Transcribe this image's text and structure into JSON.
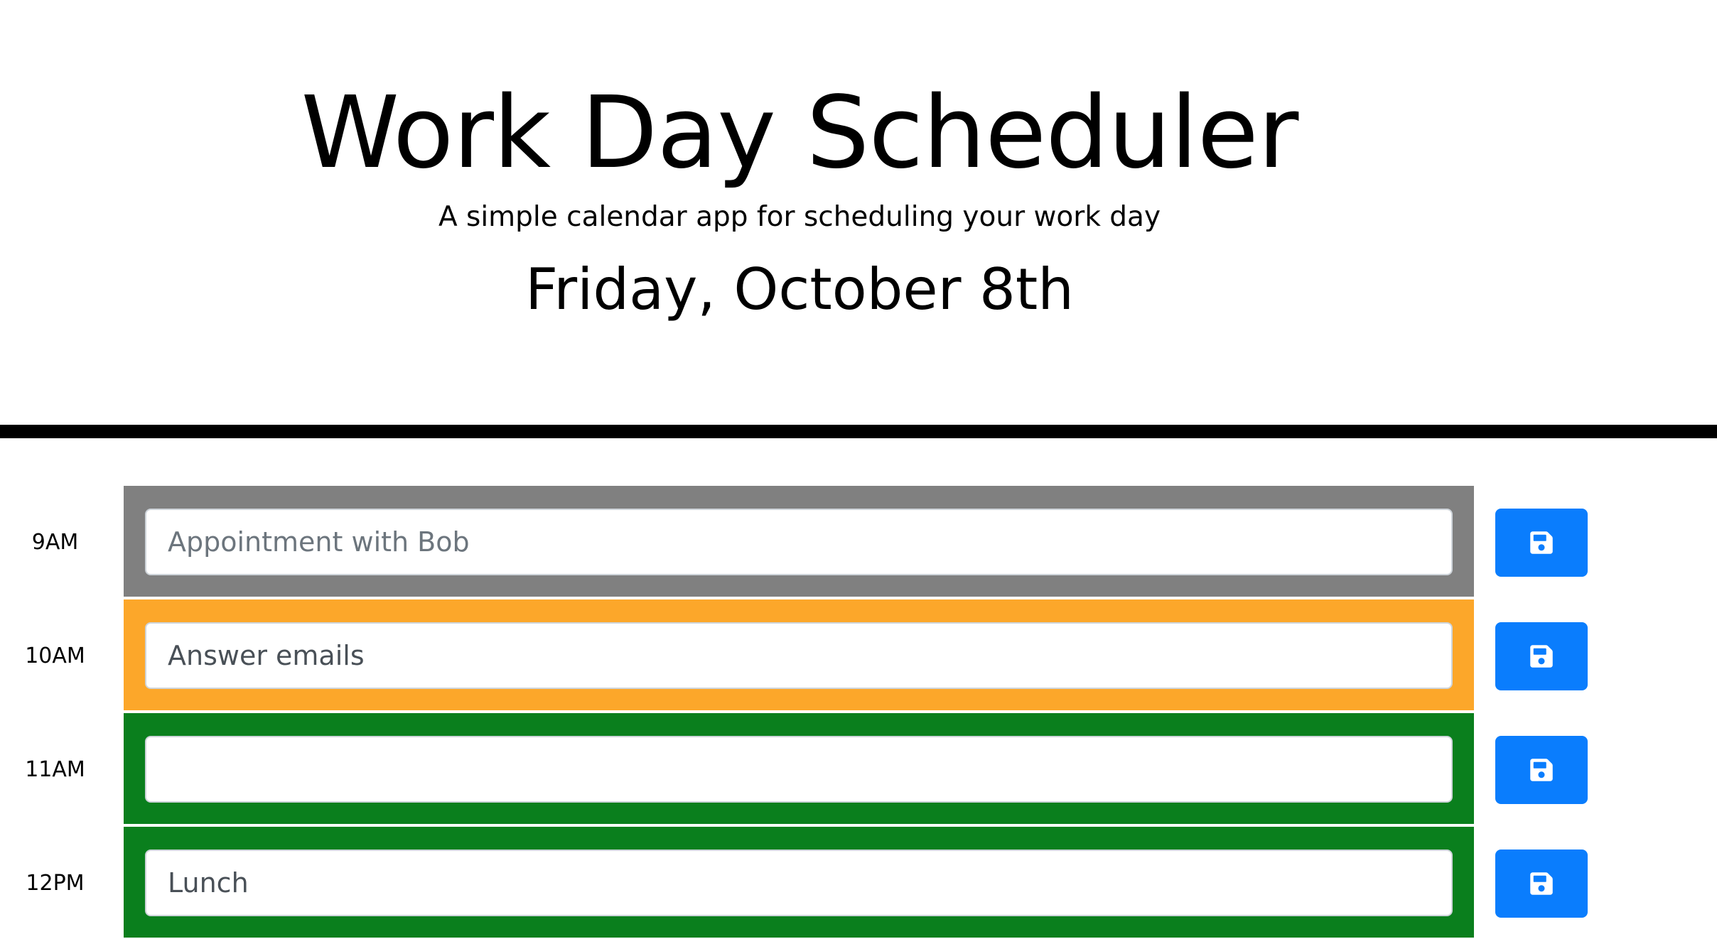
{
  "header": {
    "title": "Work Day Scheduler",
    "subtitle": "A simple calendar app for scheduling your work day",
    "current_day": "Friday, October 8th"
  },
  "colors": {
    "past": "#808080",
    "present": "#fca72a",
    "future": "#0a7f1d",
    "save_button": "#0a7dfd"
  },
  "time_blocks": [
    {
      "hour": "9AM",
      "status": "past",
      "value": "",
      "placeholder": "Appointment with Bob",
      "save_icon": "save-icon"
    },
    {
      "hour": "10AM",
      "status": "present",
      "value": "Answer emails",
      "placeholder": "",
      "save_icon": "save-icon"
    },
    {
      "hour": "11AM",
      "status": "future",
      "value": "",
      "placeholder": "",
      "save_icon": "save-icon"
    },
    {
      "hour": "12PM",
      "status": "future",
      "value": "Lunch",
      "placeholder": "",
      "save_icon": "save-icon"
    }
  ]
}
